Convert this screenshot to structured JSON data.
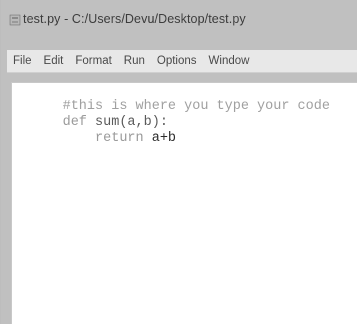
{
  "window": {
    "title": "test.py - C:/Users/Devu/Desktop/test.py"
  },
  "menubar": {
    "items": [
      "File",
      "Edit",
      "Format",
      "Run",
      "Options",
      "Window"
    ]
  },
  "editor": {
    "line1": {
      "comment": "#this is where you type your code"
    },
    "line2": {
      "keyword": "def",
      "name": "sum(a,b):"
    },
    "line3": {
      "indent": "    ",
      "keyword": "return",
      "expr": "a+b"
    }
  },
  "colors": {
    "window_bg": "#dcdcdc",
    "editor_bg": "#ffffff",
    "comment": "#a0a0a0",
    "keyword": "#9a9a9a"
  }
}
